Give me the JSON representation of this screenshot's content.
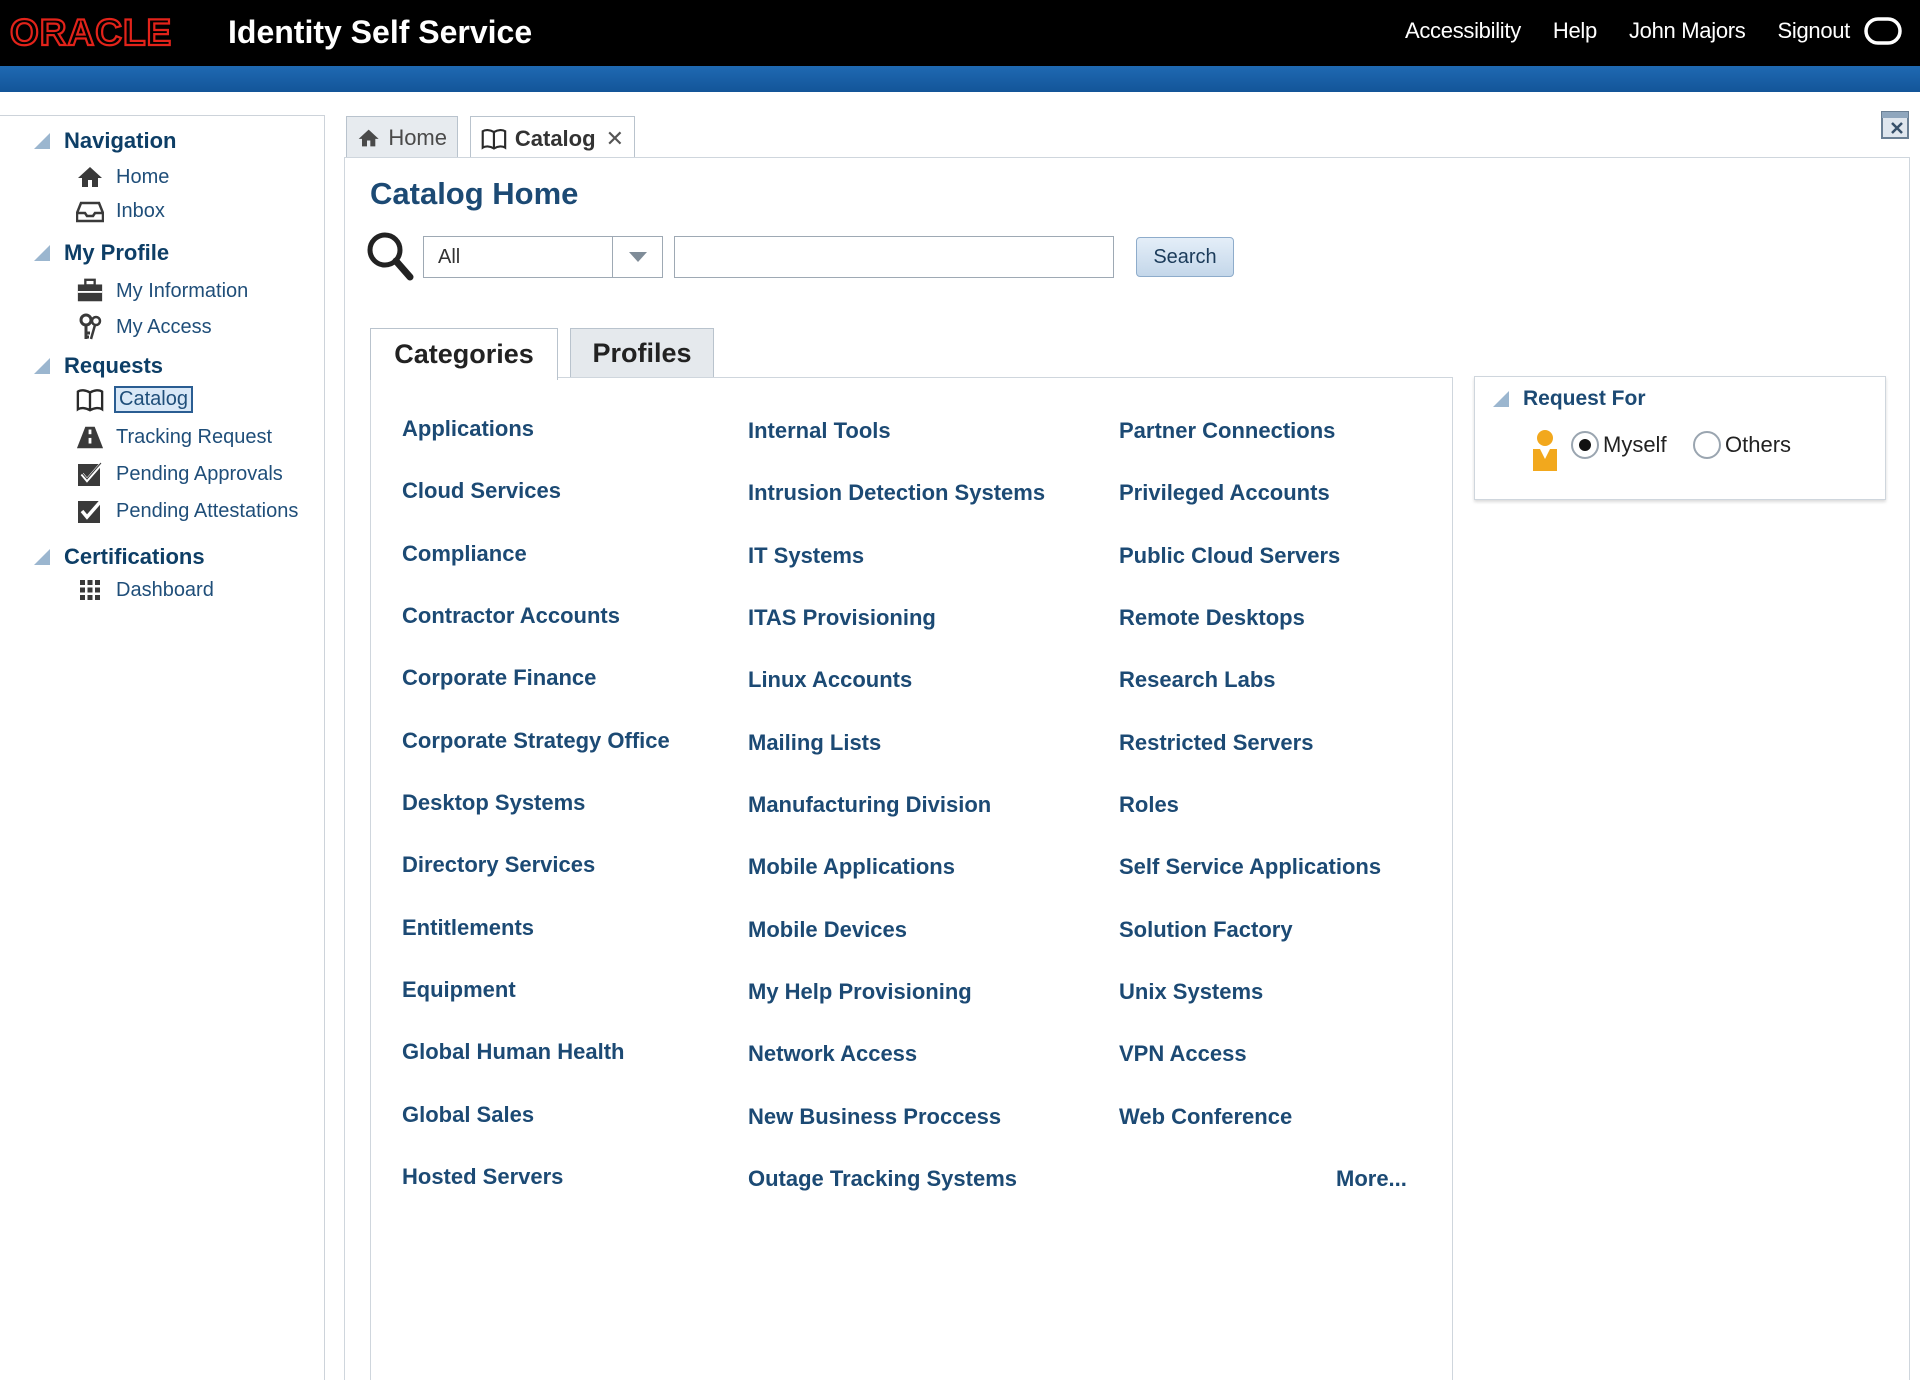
{
  "header": {
    "logo_text": "ORACLE",
    "app_title": "Identity Self Service",
    "links": [
      "Accessibility",
      "Help",
      "John Majors",
      "Signout"
    ]
  },
  "colors": {
    "header_bg": "#000000",
    "brand_red": "#e2231a",
    "accent_blue": "#1a5fa8",
    "link_blue": "#1c4a74"
  },
  "nav": {
    "sections": [
      {
        "label": "Navigation",
        "items": [
          {
            "label": "Home",
            "icon": "home-icon"
          },
          {
            "label": "Inbox",
            "icon": "inbox-icon"
          }
        ]
      },
      {
        "label": "My Profile",
        "items": [
          {
            "label": "My Information",
            "icon": "briefcase-icon"
          },
          {
            "label": "My Access",
            "icon": "keys-icon"
          }
        ]
      },
      {
        "label": "Requests",
        "items": [
          {
            "label": "Catalog",
            "icon": "book-icon",
            "selected": true
          },
          {
            "label": "Tracking Request",
            "icon": "road-icon"
          },
          {
            "label": "Pending Approvals",
            "icon": "checkbox-icon"
          },
          {
            "label": "Pending Attestations",
            "icon": "checkbox-icon"
          }
        ]
      },
      {
        "label": "Certifications",
        "items": [
          {
            "label": "Dashboard",
            "icon": "grid-icon"
          }
        ]
      }
    ]
  },
  "page_tabs": [
    {
      "label": "Home",
      "icon": "home-icon"
    },
    {
      "label": "Catalog",
      "icon": "book-icon",
      "active": true,
      "closable": true
    }
  ],
  "catalog": {
    "title": "Catalog Home",
    "search": {
      "filter_value": "All",
      "query": "",
      "button_label": "Search"
    },
    "tabs": [
      "Categories",
      "Profiles"
    ],
    "active_tab": "Categories",
    "columns": [
      [
        "Applications",
        "Cloud Services",
        "Compliance",
        "Contractor Accounts",
        "Corporate Finance",
        "Corporate Strategy Office",
        "Desktop Systems",
        "Directory Services",
        "Entitlements",
        "Equipment",
        "Global Human Health",
        "Global Sales",
        "Hosted Servers"
      ],
      [
        "Internal Tools",
        "Intrusion Detection Systems",
        "IT Systems",
        "ITAS Provisioning",
        "Linux Accounts",
        "Mailing Lists",
        "Manufacturing Division",
        "Mobile Applications",
        "Mobile Devices",
        "My Help Provisioning",
        "Network Access",
        "New Business Proccess",
        "Outage Tracking Systems"
      ],
      [
        "Partner Connections",
        "Privileged Accounts",
        "Public Cloud Servers",
        "Remote Desktops",
        "Research Labs",
        "Restricted Servers",
        "Roles",
        "Self Service Applications",
        "Solution Factory",
        "Unix Systems",
        "VPN Access",
        "Web Conference"
      ]
    ],
    "more_label": "More..."
  },
  "request_for": {
    "title": "Request For",
    "options": [
      "Myself",
      "Others"
    ],
    "selected": "Myself"
  }
}
